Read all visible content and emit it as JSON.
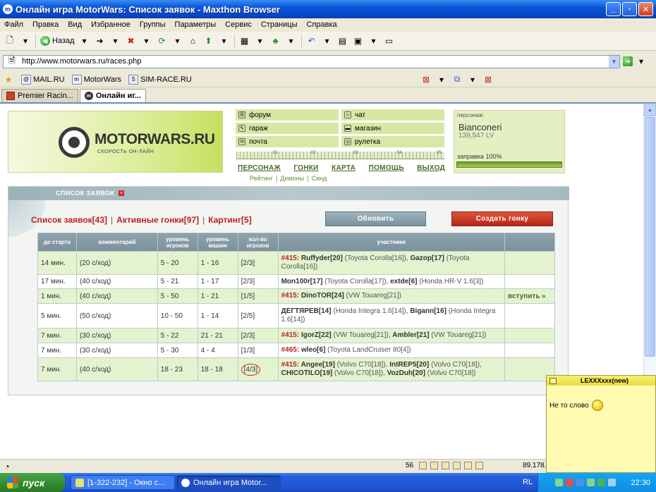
{
  "window": {
    "title": "Онлайн игра MotorWars: Список заявок - Maxthon Browser",
    "min": "_",
    "max": "▫",
    "close": "✕"
  },
  "menu": [
    "Файл",
    "Правка",
    "Вид",
    "Избранное",
    "Группы",
    "Параметры",
    "Сервис",
    "Страницы",
    "Справка"
  ],
  "toolbar": {
    "back_label": "Назад"
  },
  "address": {
    "url": "http://www.motorwars.ru/races.php"
  },
  "favorites": [
    "MAIL.RU",
    "MotorWars",
    "SIM-RACE.RU"
  ],
  "tabs": [
    "Premier Racin...",
    "Онлайн иг..."
  ],
  "site": {
    "logo_text": "MOTORWARS.RU",
    "logo_sub": "СКОРОСТЬ ОН-ЛАЙН",
    "nav": [
      "форум",
      "чат",
      "гараж",
      "магазин",
      "почта",
      "рулетка"
    ],
    "ruler_marks": [
      "01",
      "02",
      "03",
      "04",
      "05"
    ],
    "main_links": [
      "ПЕРСОНАЖ",
      "ГОНКИ",
      "КАРТА",
      "ПОМОЩЬ",
      "ВЫХОД"
    ],
    "sub_links": [
      "Рейтинг",
      "|",
      "Демоны",
      "|",
      "Синд"
    ],
    "persona": {
      "label": "персонаж:",
      "name": "Bianconeri",
      "lv": "139,547 LV",
      "fuel": "заправка 100%",
      "fuel_level": 1.0
    }
  },
  "panel": {
    "title": "СПИСОК ЗАЯВОК",
    "filters": [
      "Список заявок[43]",
      "Активные гонки[97]",
      "Картинг[5]"
    ],
    "refresh": "Обновить",
    "create": "Создать гонку"
  },
  "table": {
    "headers": [
      "до старта",
      "комментарий",
      "уровень игроков",
      "уровень машин",
      "кол-во игроков",
      "участники",
      ""
    ],
    "rows": [
      {
        "start": "14 мин.",
        "comment": "(20 с/ход)",
        "plevel": "5 - 20",
        "clevel": "1 - 16",
        "count": "[2/3]",
        "join": "",
        "circled": false,
        "shaded": true,
        "parts": [
          {
            "id": "#415: "
          },
          {
            "name": "Ruffyder[20]",
            "car": " (Toyota Corolla[16]), "
          },
          {
            "name": "Gazop[17]",
            "car": " (Toyota Corolla[16])"
          }
        ]
      },
      {
        "start": "17 мин.",
        "comment": "(40 с/ход)",
        "plevel": "5 - 21",
        "clevel": "1 - 17",
        "count": "[2/3]",
        "join": "",
        "circled": false,
        "shaded": false,
        "parts": [
          {
            "name": "Mon100r[17]",
            "car": " (Toyota Corolla[17]), "
          },
          {
            "name": "extde[6]",
            "car": " (Honda HR-V 1.6[3])"
          }
        ]
      },
      {
        "start": "1 мин.",
        "comment": "(40 с/ход)",
        "plevel": "5 - 50",
        "clevel": "1 - 21",
        "count": "[1/5]",
        "join": "вступить »",
        "circled": false,
        "shaded": true,
        "parts": [
          {
            "id": "#415: "
          },
          {
            "name": "DinoTOR[24]",
            "car": " (VW Touareg[21])"
          }
        ]
      },
      {
        "start": "5 мин.",
        "comment": "(50 с/ход)",
        "plevel": "10 - 50",
        "clevel": "1 - 14",
        "count": "[2/5]",
        "join": "",
        "circled": false,
        "shaded": false,
        "parts": [
          {
            "name": "ДЕГТЯРЕВ[14]",
            "car": " (Honda Integra 1.6[14]), "
          },
          {
            "name": "Bigann[16]",
            "car": " (Honda Integra 1.6[14])"
          }
        ]
      },
      {
        "start": "7 мин.",
        "comment": "(30 с/ход)",
        "plevel": "5 - 22",
        "clevel": "21 - 21",
        "count": "[2/3]",
        "join": "",
        "circled": false,
        "shaded": true,
        "parts": [
          {
            "id": "#415: "
          },
          {
            "name": "IgorZ[22]",
            "car": " (VW Touareg[21]), "
          },
          {
            "name": "Ambler[21]",
            "car": " (VW Touareg[21])"
          }
        ]
      },
      {
        "start": "7 мин.",
        "comment": "(30 с/ход)",
        "plevel": "5 - 30",
        "clevel": "4 - 4",
        "count": "[1/3]",
        "join": "",
        "circled": false,
        "shaded": false,
        "parts": [
          {
            "id": "#465: "
          },
          {
            "name": "wleo[6]",
            "car": " (Toyota LandCruiser 80[4])"
          }
        ]
      },
      {
        "start": "7 мин.",
        "comment": "(40 с/ход)",
        "plevel": "18 - 23",
        "clevel": "18 - 18",
        "count": "[4/3]",
        "join": "",
        "circled": true,
        "shaded": true,
        "parts": [
          {
            "id": "#415: "
          },
          {
            "name": "Angee[19]",
            "car": " (Volvo C70[18]), "
          },
          {
            "name": "IntREP5[20]",
            "car": " (Volvo C70[18]), "
          },
          {
            "name": "CHICOTILO[19]",
            "car": " (Volvo C70[18]), "
          },
          {
            "name": "VozDuh[20]",
            "car": " (Volvo C70[18])"
          }
        ]
      }
    ]
  },
  "statusbar": {
    "num": "56",
    "ip": "89.178."
  },
  "taskbar": {
    "start": "пуск",
    "tasks": [
      "[1-322-232] - Окно с...",
      "Онлайн игра Motor..."
    ],
    "lang": "RL",
    "clock": "22:30"
  },
  "chat": {
    "title": "LEXXXxxx(new)",
    "message": "Не то слово"
  }
}
